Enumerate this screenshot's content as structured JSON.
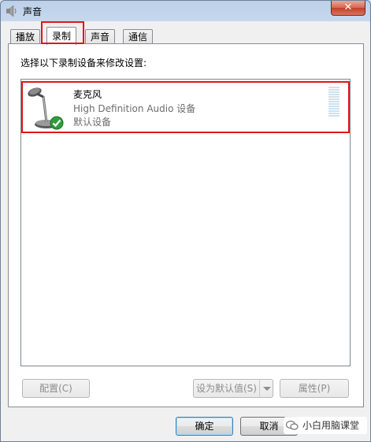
{
  "window": {
    "title": "声音",
    "close_label": "✕"
  },
  "tabs": [
    {
      "label": "播放",
      "active": false
    },
    {
      "label": "录制",
      "active": true
    },
    {
      "label": "声音",
      "active": false
    },
    {
      "label": "通信",
      "active": false
    }
  ],
  "panel": {
    "instruction": "选择以下录制设备来修改设置:",
    "devices": [
      {
        "name": "麦克风",
        "description": "High Definition Audio 设备",
        "status": "默认设备",
        "icon": "microphone-icon",
        "default_badge": "checkmark-icon"
      }
    ]
  },
  "buttons": {
    "configure": "配置(C)",
    "set_default": "设为默认值(S)",
    "properties": "属性(P)",
    "ok": "确定",
    "cancel": "取消"
  },
  "watermark": {
    "text": "小白用脑课堂"
  },
  "colors": {
    "highlight_border": "#e1161a",
    "title_bar": "#c7d8ee"
  }
}
